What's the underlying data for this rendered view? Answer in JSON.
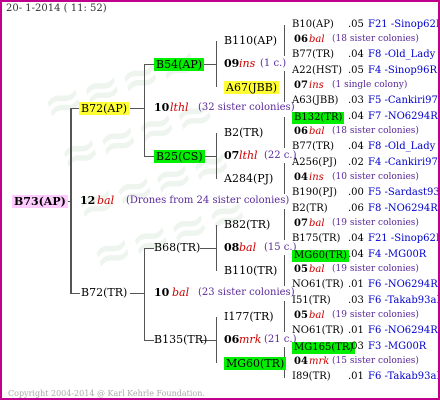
{
  "header": {
    "date": "20- 1-2014 ( 11: 52)"
  },
  "footer": {
    "copyright": "Copyright 2004-2014 @ Karl Kehrle Foundation."
  },
  "root": {
    "name": "B73(AP)",
    "num": "12",
    "tag": "bal",
    "note": "(Drones from 24 sister colonies)"
  },
  "gen1": [
    {
      "name": "B72(AP)",
      "num": "10",
      "tag": "lthl",
      "note": "(32 sister colonies)"
    },
    {
      "name": "B72(TR)",
      "num": "10",
      "tag": "bal",
      "note": "(23 sister colonies)"
    }
  ],
  "gen2": [
    {
      "name": "B54(AP)",
      "num": "09",
      "tag": "ins",
      "note": "(1 c.)"
    },
    {
      "name": "B25(CS)",
      "num": "07",
      "tag": "lthl",
      "note": "(22 c.)"
    },
    {
      "name": "B68(TR)",
      "num": "08",
      "tag": "bal",
      "note": "(15 c.)"
    },
    {
      "name": "B135(TR)",
      "num": "06",
      "tag": "mrk",
      "note": "(21 c.)"
    }
  ],
  "gen3": [
    {
      "name": "B110(AP)"
    },
    {
      "name": "A67(JBB)"
    },
    {
      "name": "B2(TR)"
    },
    {
      "name": "A284(PJ)"
    },
    {
      "name": "B82(TR)"
    },
    {
      "name": "B110(TR)"
    },
    {
      "name": "I177(TR)"
    },
    {
      "name": "MG60(TR)"
    }
  ],
  "gen4": [
    {
      "name": "B10(AP)",
      "val": ".05",
      "code": "F21 -Sinop62R"
    },
    {
      "num": "06",
      "tag": "bal",
      "note": "(18 sister colonies)"
    },
    {
      "name": "B77(TR)",
      "val": ".04",
      "code": "F8 -Old_Lady"
    },
    {
      "name": "A22(HST)",
      "val": ".05",
      "code": "F4 -Sinop96R"
    },
    {
      "num": "07",
      "tag": "ins",
      "note": "(1 single colony)"
    },
    {
      "name": "A63(JBB)",
      "val": ".03",
      "code": "F5 -Cankiri97Q"
    },
    {
      "name": "B132(TR)",
      "val": ".04",
      "code": "F7 -NO6294R"
    },
    {
      "num": "06",
      "tag": "bal",
      "note": "(18 sister colonies)"
    },
    {
      "name": "B77(TR)",
      "val": ".04",
      "code": "F8 -Old_Lady"
    },
    {
      "name": "A256(PJ)",
      "val": ".02",
      "code": "F4 -Cankiri97Q"
    },
    {
      "num": "04",
      "tag": "ins",
      "note": "(10 sister colonies)"
    },
    {
      "name": "B190(PJ)",
      "val": ".00",
      "code": "F5 -Sardast93R"
    },
    {
      "name": "B2(TR)",
      "val": ".06",
      "code": "F8 -NO6294R"
    },
    {
      "num": "07",
      "tag": "bal",
      "note": "(19 sister colonies)"
    },
    {
      "name": "B175(TR)",
      "val": ".04",
      "code": "F21 -Sinop62R"
    },
    {
      "name": "MG60(TR)",
      "val": ".04",
      "code": "F4 -MG00R"
    },
    {
      "num": "05",
      "tag": "bal",
      "note": "(19 sister colonies)"
    },
    {
      "name": "NO61(TR)",
      "val": ".01",
      "code": "F6 -NO6294R"
    },
    {
      "name": "I51(TR)",
      "val": ".03",
      "code": "F6 -Takab93aR"
    },
    {
      "num": "05",
      "tag": "bal",
      "note": "(19 sister colonies)"
    },
    {
      "name": "NO61(TR)",
      "val": ".01",
      "code": "F6 -NO6294R"
    },
    {
      "name": "MG165(TR)",
      "val": ".03",
      "code": "F3 -MG00R"
    },
    {
      "num": "04",
      "tag": "mrk",
      "note": "(15 sister colonies)"
    },
    {
      "name": "I89(TR)",
      "val": ".01",
      "code": "F6 -Takab93aR"
    }
  ],
  "colors": {
    "frame": "#c0008a",
    "green": "#00ee00",
    "yellow": "#ffff33",
    "pink": "#ffccff",
    "blue": "#0000cc",
    "purple": "#5a2a9a",
    "red": "#cc0000"
  }
}
